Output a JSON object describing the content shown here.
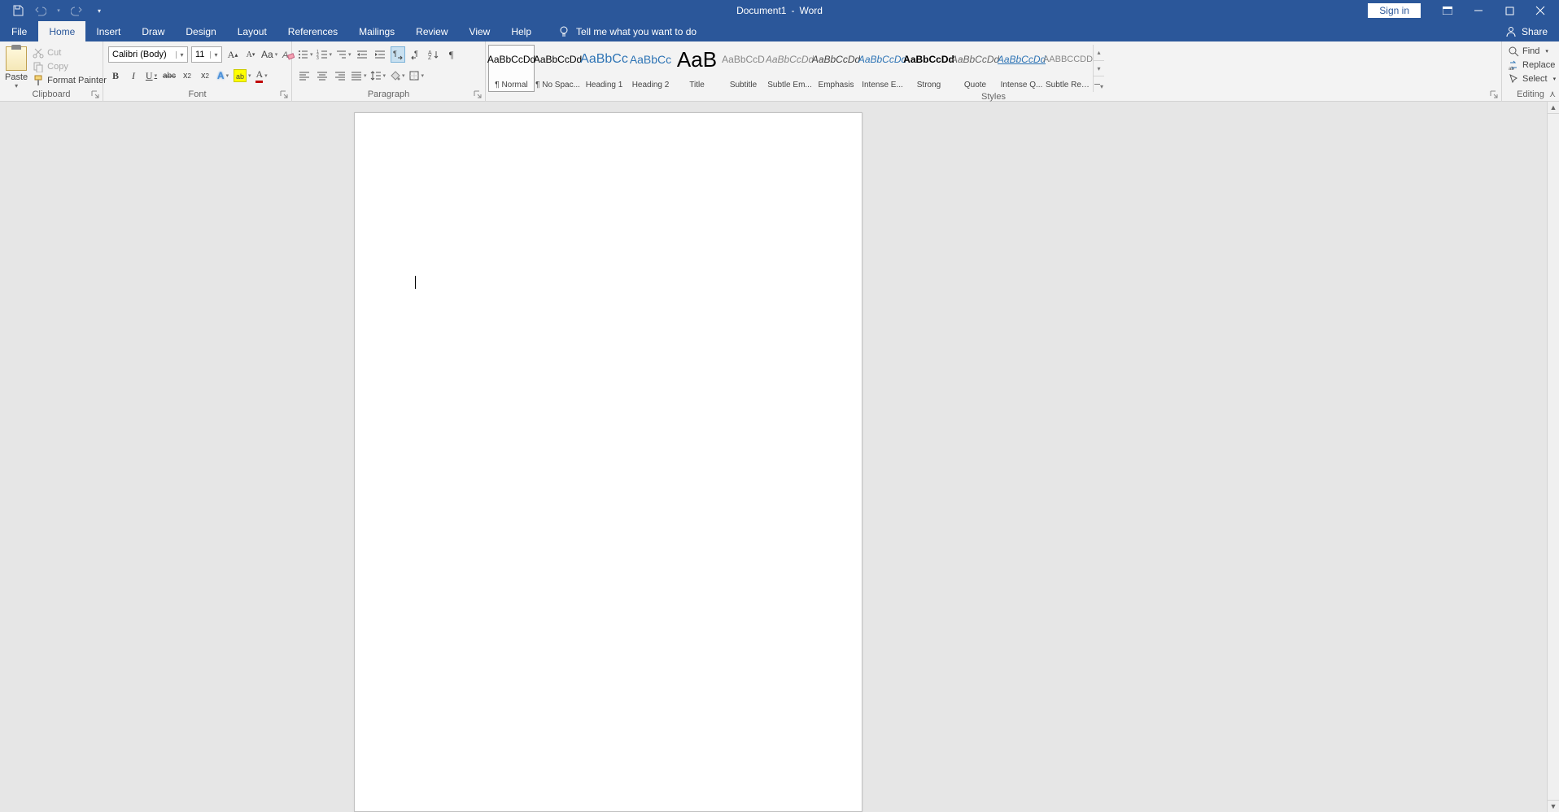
{
  "title": {
    "doc": "Document1",
    "sep": "-",
    "app": "Word"
  },
  "qat": {
    "save": "save",
    "undo": "undo",
    "redo": "redo"
  },
  "signin": "Sign in",
  "tabs": [
    "File",
    "Home",
    "Insert",
    "Draw",
    "Design",
    "Layout",
    "References",
    "Mailings",
    "Review",
    "View",
    "Help"
  ],
  "active_tab": "Home",
  "tell_me": "Tell me what you want to do",
  "share": "Share",
  "clipboard": {
    "paste": "Paste",
    "cut": "Cut",
    "copy": "Copy",
    "format_painter": "Format Painter",
    "label": "Clipboard"
  },
  "font": {
    "name": "Calibri (Body)",
    "size": "11",
    "label": "Font"
  },
  "paragraph": {
    "label": "Paragraph"
  },
  "styles": {
    "label": "Styles",
    "items": [
      {
        "preview": "AaBbCcDd",
        "name": "¶ Normal",
        "color": "#000",
        "italic": false,
        "size": "12px",
        "selected": true,
        "underline": false
      },
      {
        "preview": "AaBbCcDd",
        "name": "¶ No Spac...",
        "color": "#000",
        "italic": false,
        "size": "12px",
        "selected": false,
        "underline": false
      },
      {
        "preview": "AaBbCc",
        "name": "Heading 1",
        "color": "#2e74b5",
        "italic": false,
        "size": "16px",
        "selected": false,
        "underline": false
      },
      {
        "preview": "AaBbCc",
        "name": "Heading 2",
        "color": "#2e74b5",
        "italic": false,
        "size": "14px",
        "selected": false,
        "underline": false
      },
      {
        "preview": "AaB",
        "name": "Title",
        "color": "#000",
        "italic": false,
        "size": "26px",
        "selected": false,
        "underline": false
      },
      {
        "preview": "AaBbCcD",
        "name": "Subtitle",
        "color": "#888",
        "italic": false,
        "size": "12px",
        "selected": false,
        "underline": false
      },
      {
        "preview": "AaBbCcDd",
        "name": "Subtle Em...",
        "color": "#888",
        "italic": true,
        "size": "12px",
        "selected": false,
        "underline": false
      },
      {
        "preview": "AaBbCcDd",
        "name": "Emphasis",
        "color": "#444",
        "italic": true,
        "size": "12px",
        "selected": false,
        "underline": false
      },
      {
        "preview": "AaBbCcDd",
        "name": "Intense E...",
        "color": "#2e74b5",
        "italic": true,
        "size": "12px",
        "selected": false,
        "underline": false
      },
      {
        "preview": "AaBbCcDd",
        "name": "Strong",
        "color": "#000",
        "italic": false,
        "size": "12px",
        "selected": false,
        "underline": false,
        "bold": true
      },
      {
        "preview": "AaBbCcDd",
        "name": "Quote",
        "color": "#666",
        "italic": true,
        "size": "12px",
        "selected": false,
        "underline": false
      },
      {
        "preview": "AaBbCcDd",
        "name": "Intense Q...",
        "color": "#2e74b5",
        "italic": true,
        "size": "12px",
        "selected": false,
        "underline": true
      },
      {
        "preview": "AABBCCDD",
        "name": "Subtle Ref...",
        "color": "#888",
        "italic": false,
        "size": "11px",
        "selected": false,
        "underline": false
      }
    ]
  },
  "editing": {
    "find": "Find",
    "replace": "Replace",
    "select": "Select",
    "label": "Editing"
  }
}
